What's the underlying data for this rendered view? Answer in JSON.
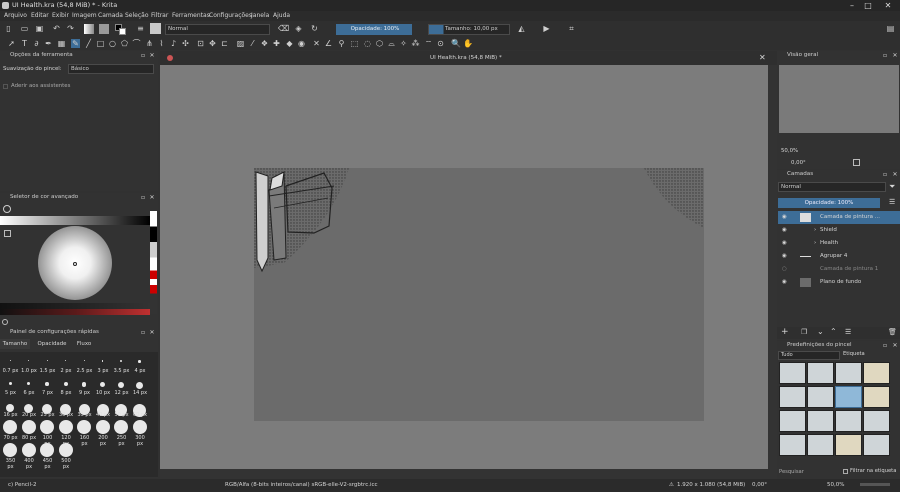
{
  "window": {
    "title": "UI Health.kra (54,8 MiB) * - Krita",
    "minimize": "–",
    "maximize": "□",
    "close": "✕"
  },
  "menu": [
    "Arquivo",
    "Editar",
    "Exibir",
    "Imagem",
    "Camada",
    "Seleção",
    "Filtrar",
    "Ferramentas",
    "Configurações",
    "Janela",
    "Ajuda"
  ],
  "toolbar": {
    "blend_mode": "Normal",
    "opacity": "Opacidade: 100%",
    "size": "Tamanho: 10,00 px"
  },
  "tool_options": {
    "title": "Opções da ferramenta",
    "smoothing_label": "Suavização do pincel:",
    "smoothing_value": "Básico",
    "snap_label": "Aderir aos assistentes"
  },
  "color_selector": {
    "title": "Seletor de cor avançado"
  },
  "quick_settings": {
    "title": "Painel de configurações rápidas",
    "tabs": [
      "Tamanho",
      "Opacidade",
      "Fluxo"
    ],
    "rows": [
      [
        "0.7 px",
        "1.0 px",
        "1.5 px",
        "2 px",
        "2.5 px",
        "3 px",
        "3.5 px",
        "4 px"
      ],
      [
        "5 px",
        "6 px",
        "7 px",
        "8 px",
        "9 px",
        "10 px",
        "12 px",
        "14 px"
      ],
      [
        "16 px",
        "20 px",
        "25 px",
        "30 px",
        "35 px",
        "40 px",
        "50 px",
        "60 px"
      ],
      [
        "70 px",
        "80 px",
        "100 px",
        "120 px",
        "160 px",
        "200 px",
        "250 px",
        "300 px"
      ],
      [
        "350 px",
        "400 px",
        "450 px",
        "500 px"
      ]
    ]
  },
  "document": {
    "tab_title": "UI Health.kra (54,8 MiB) *"
  },
  "overview": {
    "title": "Visão geral",
    "zoom": "50,0%",
    "rotation": "0,00°"
  },
  "layers": {
    "title": "Camadas",
    "blend": "Normal",
    "opacity": "Opacidade: 100%",
    "items": [
      {
        "name": "Camada de pintura ...",
        "selected": true
      },
      {
        "name": "Shield",
        "selected": false
      },
      {
        "name": "Health",
        "selected": false
      },
      {
        "name": "Agrupar 4",
        "selected": false
      },
      {
        "name": "Camada de pintura 1",
        "selected": false
      },
      {
        "name": "Plano de fundo",
        "selected": false
      }
    ]
  },
  "brush_presets": {
    "title": "Predefinições do pincel",
    "filter": "Tudo",
    "tag": "Etiqueta",
    "search": "Pesquisar",
    "filter_tag": "Filtrar na etiqueta"
  },
  "status": {
    "brush": "c) Pencil-2",
    "color_profile": "RGB/Alfa (8-bits inteiros/canal)  sRGB-elle-V2-srgbtrc.icc",
    "dimensions": "1.920 x 1.080 (54,8 MiB)",
    "rotation": "0,00°",
    "zoom": "50,0%"
  },
  "colors": {
    "accent": "#3d6d97",
    "bg": "#313131",
    "canvas": "#7c7c7c",
    "doc": "#6b6b6b"
  }
}
